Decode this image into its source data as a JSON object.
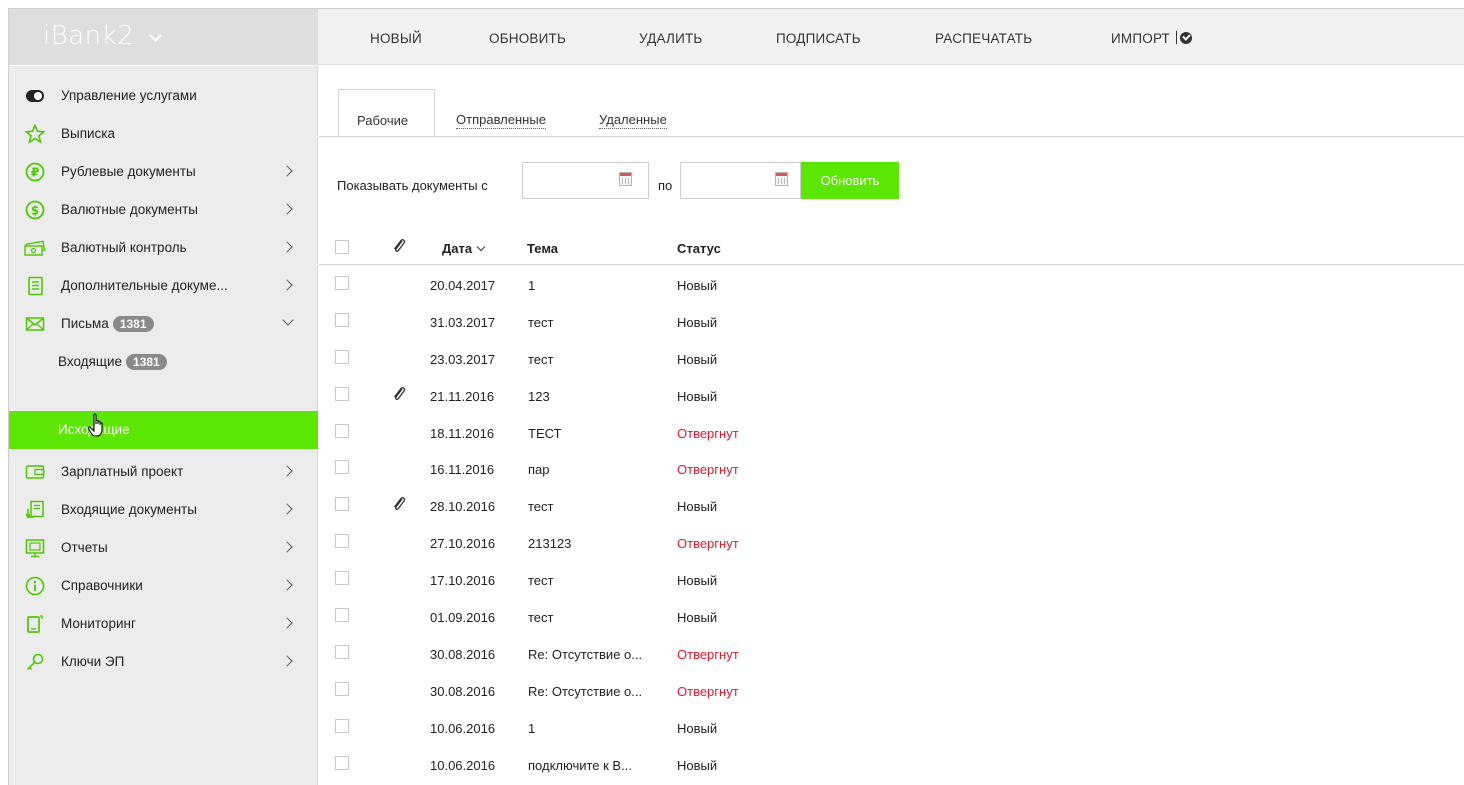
{
  "app": {
    "logo": "iBank2"
  },
  "toolbar": {
    "items": [
      "НОВЫЙ",
      "ОБНОВИТЬ",
      "УДАЛИТЬ",
      "ПОДПИСАТЬ",
      "РАСПЕЧАТАТЬ",
      "ИМПОРТ"
    ]
  },
  "sidebar": {
    "items": [
      {
        "label": "Управление услугами",
        "icon": "toggle-icon"
      },
      {
        "label": "Выписка",
        "icon": "star-icon"
      },
      {
        "label": "Рублевые документы",
        "icon": "ruble-icon"
      },
      {
        "label": "Валютные документы",
        "icon": "dollar-icon"
      },
      {
        "label": "Валютный контроль",
        "icon": "money-icon"
      },
      {
        "label": "Дополнительные докуме...",
        "icon": "document-icon"
      },
      {
        "label": "Письма",
        "icon": "envelope-icon",
        "badge": "1381"
      },
      {
        "label": "Входящие",
        "badge": "1381"
      },
      {
        "label": "Исходящие"
      },
      {
        "label": "Зарплатный проект",
        "icon": "wallet-icon"
      },
      {
        "label": "Входящие документы",
        "icon": "inbox-doc-icon"
      },
      {
        "label": "Отчеты",
        "icon": "report-icon"
      },
      {
        "label": "Справочники",
        "icon": "info-icon"
      },
      {
        "label": "Мониторинг",
        "icon": "monitor-icon"
      },
      {
        "label": "Ключи ЭП",
        "icon": "key-icon"
      }
    ],
    "accent_color": "#5ce603"
  },
  "tabs": [
    "Рабочие",
    "Отправленные",
    "Удаленные"
  ],
  "filter": {
    "label_from": "Показывать документы с",
    "label_to": "по",
    "date_from": "",
    "date_to": "",
    "button": "Обновить"
  },
  "table": {
    "headers": {
      "date": "Дата",
      "subject": "Тема",
      "status": "Статус"
    },
    "rows": [
      {
        "clip": false,
        "date": "20.04.2017",
        "subject": "1",
        "status": "Новый",
        "rejected": false
      },
      {
        "clip": false,
        "date": "31.03.2017",
        "subject": "тест",
        "status": "Новый",
        "rejected": false
      },
      {
        "clip": false,
        "date": "23.03.2017",
        "subject": "тест",
        "status": "Новый",
        "rejected": false
      },
      {
        "clip": true,
        "date": "21.11.2016",
        "subject": "123",
        "status": "Новый",
        "rejected": false
      },
      {
        "clip": false,
        "date": "18.11.2016",
        "subject": "ТЕСТ",
        "status": "Отвергнут",
        "rejected": true
      },
      {
        "clip": false,
        "date": "16.11.2016",
        "subject": "пар",
        "status": "Отвергнут",
        "rejected": true
      },
      {
        "clip": true,
        "date": "28.10.2016",
        "subject": "тест",
        "status": "Новый",
        "rejected": false
      },
      {
        "clip": false,
        "date": "27.10.2016",
        "subject": "213123",
        "status": "Отвергнут",
        "rejected": true
      },
      {
        "clip": false,
        "date": "17.10.2016",
        "subject": "тест",
        "status": "Новый",
        "rejected": false
      },
      {
        "clip": false,
        "date": "01.09.2016",
        "subject": "тест",
        "status": "Новый",
        "rejected": false
      },
      {
        "clip": false,
        "date": "30.08.2016",
        "subject": "Re: Отсутствие о...",
        "status": "Отвергнут",
        "rejected": true
      },
      {
        "clip": false,
        "date": "30.08.2016",
        "subject": "Re: Отсутствие о...",
        "status": "Отвергнут",
        "rejected": true
      },
      {
        "clip": false,
        "date": "10.06.2016",
        "subject": "1",
        "status": "Новый",
        "rejected": false
      },
      {
        "clip": false,
        "date": "10.06.2016",
        "subject": "подключите к В...",
        "status": "Новый",
        "rejected": false
      }
    ]
  }
}
